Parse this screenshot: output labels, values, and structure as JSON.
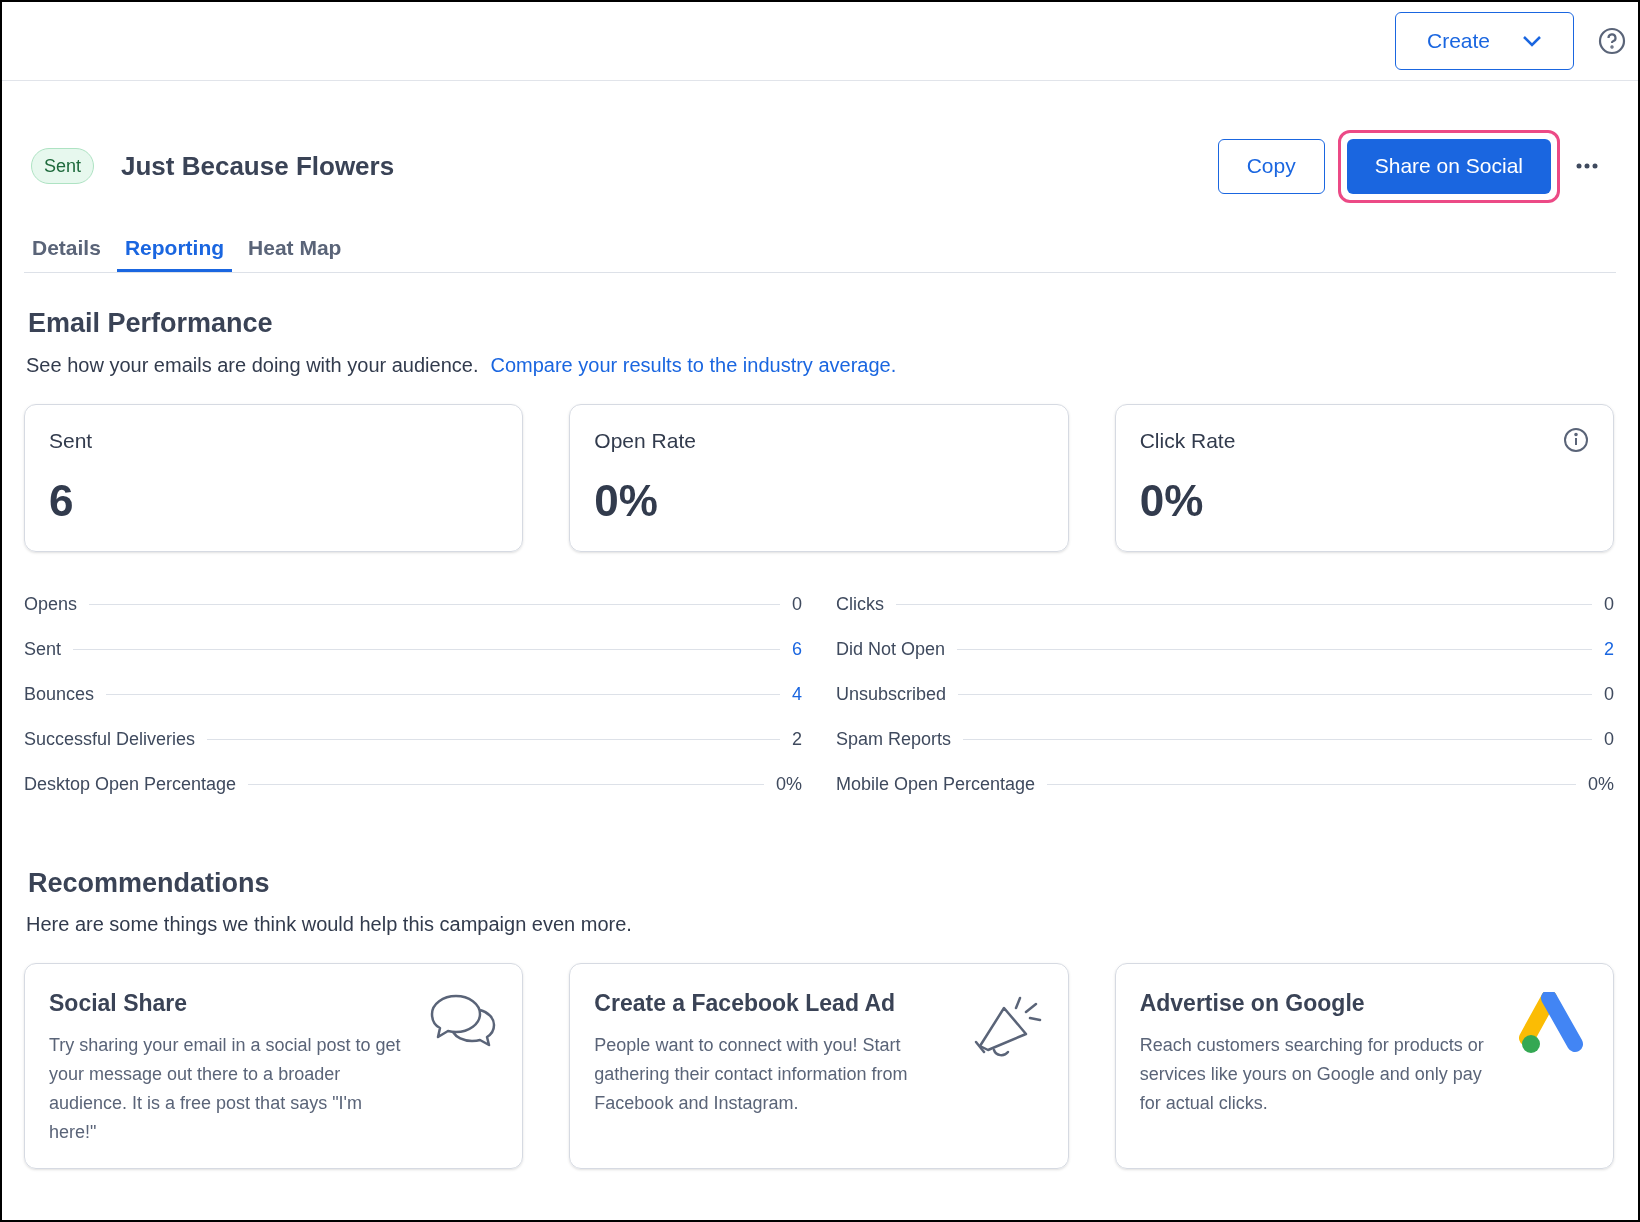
{
  "top_bar": {
    "create_button": "Create"
  },
  "campaign": {
    "status": "Sent",
    "title": "Just Because Flowers",
    "buttons": [
      {
        "label": "Copy",
        "kind": "outline",
        "highlighted": false
      },
      {
        "label": "Share on Social",
        "kind": "primary",
        "highlighted": true
      }
    ]
  },
  "tabs": [
    {
      "label": "Details",
      "selected": false
    },
    {
      "label": "Reporting",
      "selected": true
    },
    {
      "label": "Heat Map",
      "selected": false
    }
  ],
  "performance": {
    "heading": "Email Performance",
    "description": "See how your emails are doing with your audience.",
    "link": "Compare your results to the industry average.",
    "cards": [
      {
        "label": "Sent",
        "value": "6",
        "info": false
      },
      {
        "label": "Open Rate",
        "value": "0%",
        "info": false
      },
      {
        "label": "Click Rate",
        "value": "0%",
        "info": true
      }
    ],
    "stats_left": [
      {
        "label": "Opens",
        "value": "0",
        "link": false
      },
      {
        "label": "Sent",
        "value": "6",
        "link": true
      },
      {
        "label": "Bounces",
        "value": "4",
        "link": true
      },
      {
        "label": "Successful Deliveries",
        "value": "2",
        "link": false
      },
      {
        "label": "Desktop Open Percentage",
        "value": "0%",
        "link": false
      }
    ],
    "stats_right": [
      {
        "label": "Clicks",
        "value": "0",
        "link": false
      },
      {
        "label": "Did Not Open",
        "value": "2",
        "link": true
      },
      {
        "label": "Unsubscribed",
        "value": "0",
        "link": false
      },
      {
        "label": "Spam Reports",
        "value": "0",
        "link": false
      },
      {
        "label": "Mobile Open Percentage",
        "value": "0%",
        "link": false
      }
    ]
  },
  "recommendations": {
    "heading": "Recommendations",
    "description": "Here are some things we think would help this campaign even more.",
    "cards": [
      {
        "kind": "chat",
        "title": "Social Share",
        "text": "Try sharing your email in a social post to get your message out there to a broader audience. It is a free post that says \"I'm here!\""
      },
      {
        "kind": "megaphone",
        "title": "Create a Facebook Lead Ad",
        "text": "People want to connect with you! Start gathering their contact information from Facebook and Instagram."
      },
      {
        "kind": "ads",
        "title": "Advertise on Google",
        "text": "Reach customers searching for products or services like yours on Google and only pay for actual clicks."
      }
    ]
  }
}
